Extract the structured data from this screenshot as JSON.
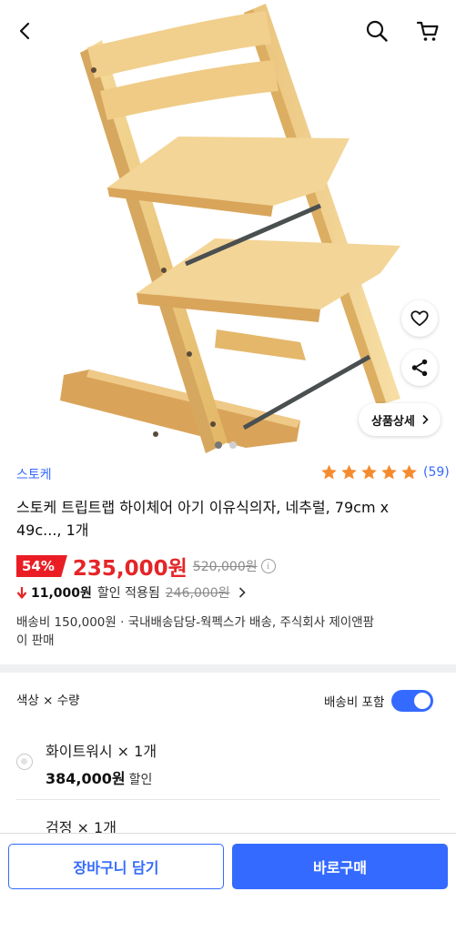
{
  "header": {
    "back_icon": "chevron-left-icon",
    "search_icon": "search-icon",
    "cart_icon": "cart-icon"
  },
  "gallery": {
    "image_subject": "wooden-high-chair",
    "detail_button_label": "상품상세",
    "page_count": 2,
    "active_page": 1
  },
  "product": {
    "brand": "스토케",
    "rating_stars": 5,
    "review_count": "(59)",
    "title": "스토케 트립트랩 하이체어 아기 이유식의자, 네추럴, 79cm x 49c..., 1개",
    "discount_rate": "54%",
    "sale_price": "235,000원",
    "original_price": "520,000원",
    "coupon_amount": "11,000원",
    "coupon_text": "할인 적용됨",
    "coupon_final_price": "246,000원",
    "shipping_text": "배송비 150,000원 · 국내배송담당-웍펙스가 배송, 주식회사 제이앤팜이 판매"
  },
  "options": {
    "header_label": "색상 × 수량",
    "shipping_toggle_label": "배송비 포함",
    "shipping_toggle_on": true,
    "items": [
      {
        "name": "화이트워시 × 1개",
        "price": "384,000원",
        "tag": "할인"
      },
      {
        "name": "검정 × 1개"
      }
    ]
  },
  "bottom_bar": {
    "cart_button": "장바구니 담기",
    "buy_button": "바로구매"
  },
  "colors": {
    "accent_blue": "#346aff",
    "sale_red": "#e52528",
    "star_orange": "#f58b2f"
  }
}
